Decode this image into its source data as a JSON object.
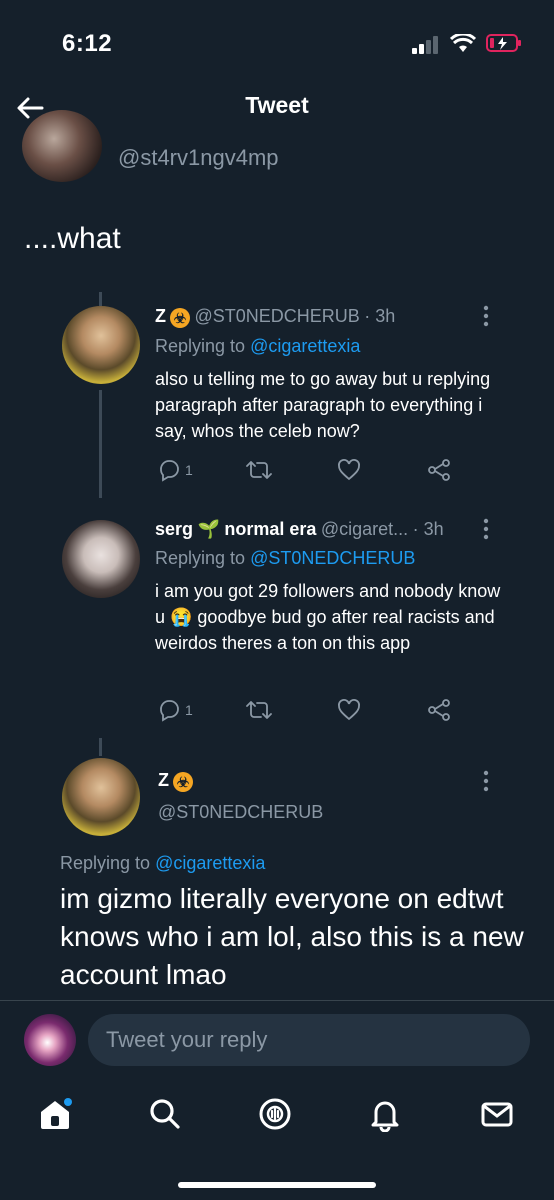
{
  "status_bar": {
    "time": "6:12"
  },
  "header": {
    "title": "Tweet"
  },
  "main_tweet": {
    "handle": "@st4rv1ngv4mp",
    "text": "....what"
  },
  "replies": [
    {
      "name": "Z",
      "handle": "@ST0NEDCHERUB",
      "time": "· 3h",
      "replying_label": "Replying to",
      "replying_to": "@cigarettexia",
      "text": "also u telling me to go away but u replying paragraph after paragraph to everything i say, whos the celeb now?",
      "reply_count": "1"
    },
    {
      "name": "serg",
      "name_suffix": "normal era",
      "handle": "@cigaret...",
      "time": "· 3h",
      "replying_label": "Replying to",
      "replying_to": "@ST0NEDCHERUB",
      "text": "i am you got 29 followers and nobody know u 😭 goodbye bud go after real racists and weirdos theres a ton on this app",
      "reply_count": "1"
    }
  ],
  "focused_tweet": {
    "name": "Z",
    "handle": "@ST0NEDCHERUB",
    "replying_label": "Replying to",
    "replying_to": "@cigarettexia",
    "text": "im gizmo literally everyone on edtwt knows who i am lol, also this is a new account lmao"
  },
  "reply_bar": {
    "placeholder": "Tweet your reply"
  },
  "colors": {
    "background": "#15202b",
    "accent": "#1d9bf0",
    "muted": "#8b98a5",
    "battery_low": "#e0245e"
  },
  "icons": [
    "back-arrow-icon",
    "more-icon",
    "reply-icon",
    "retweet-icon",
    "like-icon",
    "share-icon",
    "home-icon",
    "search-icon",
    "spaces-icon",
    "notifications-icon",
    "messages-icon"
  ]
}
